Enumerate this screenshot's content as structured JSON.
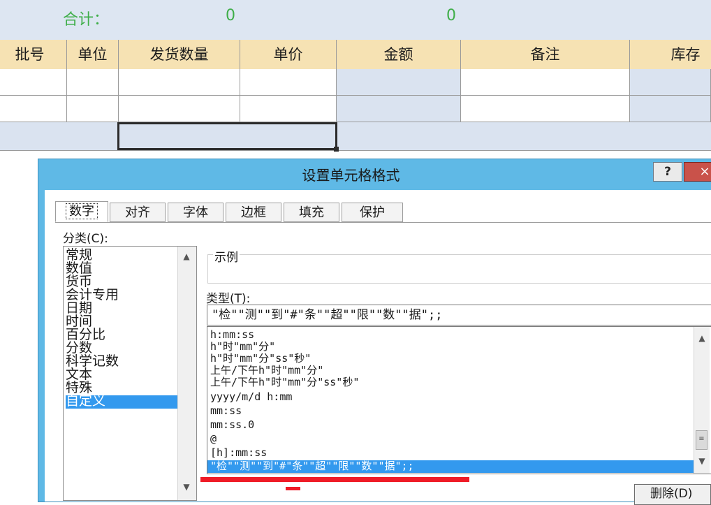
{
  "sheet": {
    "sum_label": "合计：",
    "sum_value_1": "0",
    "sum_value_2": "0",
    "headers": [
      "批号",
      "单位",
      "发货数量",
      "单价",
      "金额",
      "备注",
      "库存"
    ]
  },
  "dialog": {
    "title": "设置单元格格式",
    "help_label": "?",
    "close_label": "×",
    "tabs": [
      "数字",
      "对齐",
      "字体",
      "边框",
      "填充",
      "保护"
    ],
    "category_label": "分类(C):",
    "categories": [
      "常规",
      "数值",
      "货币",
      "会计专用",
      "日期",
      "时间",
      "百分比",
      "分数",
      "科学记数",
      "文本",
      "特殊",
      "自定义"
    ],
    "selected_category": "自定义",
    "sample_label": "示例",
    "type_label": "类型(T):",
    "type_value": "\"检\"\"测\"\"到\"#\"条\"\"超\"\"限\"\"数\"\"据\";;",
    "formats": [
      "h:mm:ss",
      "h\"时\"mm\"分\"",
      "h\"时\"mm\"分\"ss\"秒\"",
      "上午/下午h\"时\"mm\"分\"",
      "上午/下午h\"时\"mm\"分\"ss\"秒\"",
      "yyyy/m/d h:mm",
      "mm:ss",
      "mm:ss.0",
      "@",
      "[h]:mm:ss",
      "\"检\"\"测\"\"到\"#\"条\"\"超\"\"限\"\"数\"\"据\";;"
    ],
    "delete_label": "删除(D)",
    "scroll_up": "▲",
    "scroll_down": "▼"
  },
  "colors": {
    "accent_blue": "#3399ee",
    "title_bar": "#5fb9e6",
    "header_fill": "#f6e2b3",
    "sum_text": "#3fae49",
    "highlight_red": "#ef1b26"
  }
}
